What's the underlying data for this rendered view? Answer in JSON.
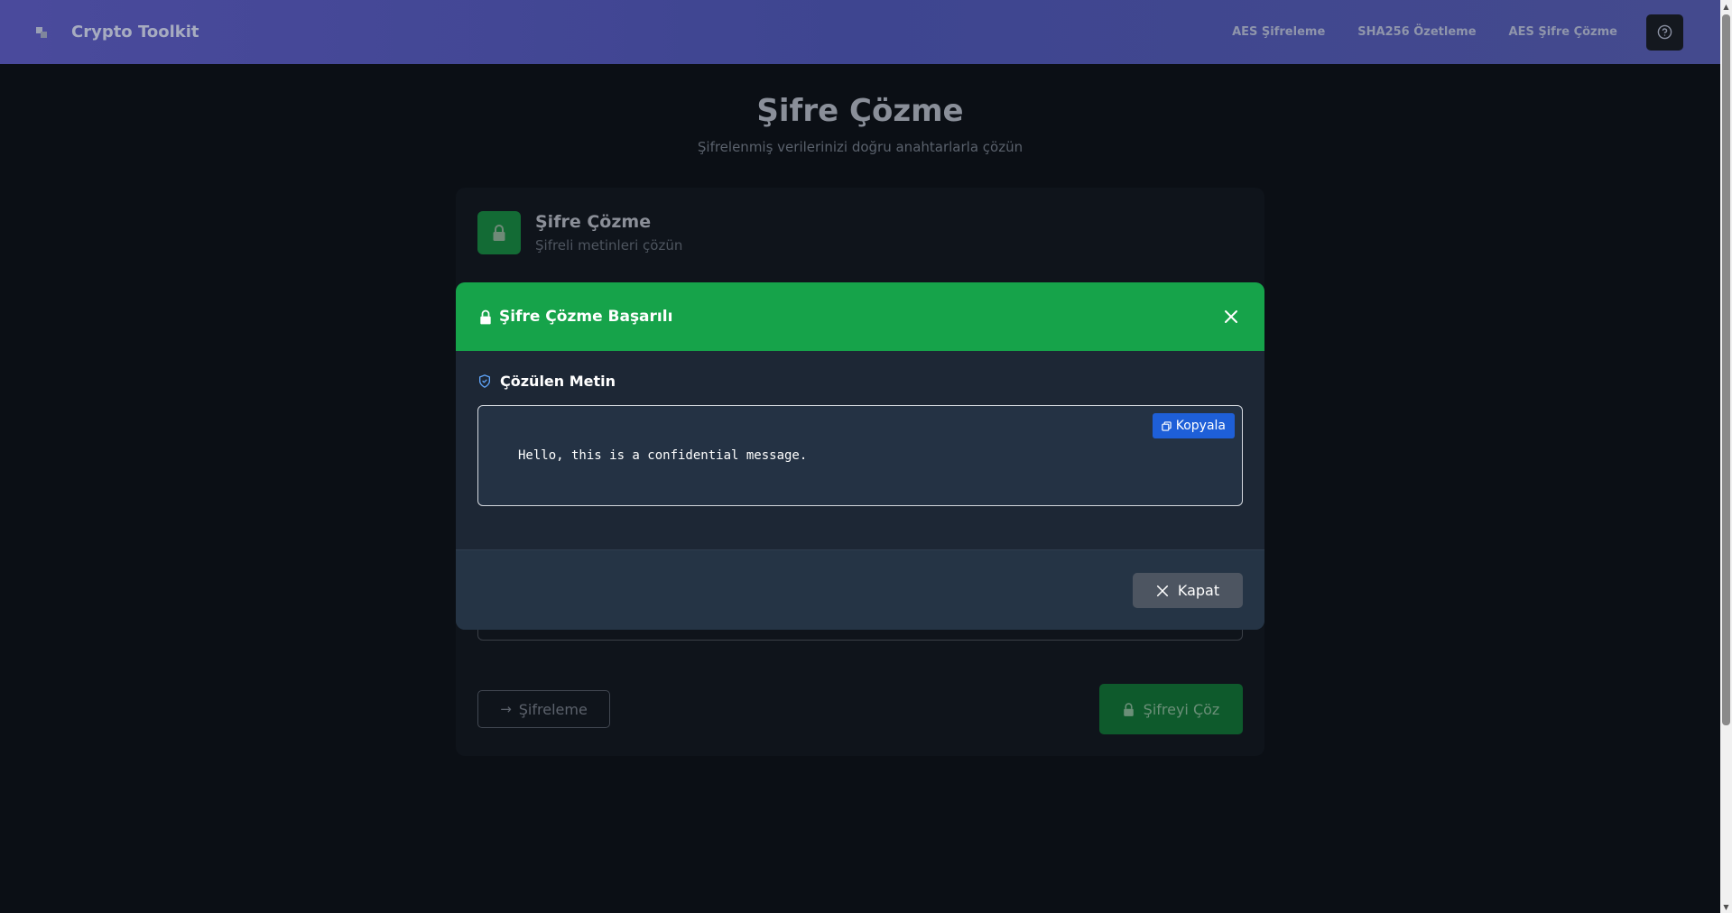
{
  "brand": {
    "name": "Crypto Toolkit",
    "logo_icon": "logo-icon"
  },
  "nav": {
    "links": [
      "AES Şifreleme",
      "SHA256 Özetleme",
      "AES Şifre Çözme"
    ],
    "help_icon": "help-circle-icon"
  },
  "page": {
    "title": "Şifre Çözme",
    "subtitle": "Şifrelenmiş verilerinizi doğru anahtarlarla çözün"
  },
  "card": {
    "title": "Şifre Çözme",
    "subtitle": "Şifreli metinleri çözün",
    "back_label": "Şifreleme",
    "decrypt_label": "Şifreyi Çöz"
  },
  "modal": {
    "title": "Şifre Çözme Başarılı",
    "section_label": "Çözülen Metin",
    "result_text": "Hello, this is a confidential message.",
    "copy_label": "Kopyala",
    "close_label": "Kapat"
  },
  "colors": {
    "success": "#16a34a",
    "copy_button": "#1e5fd8",
    "close_button": "#4d5561",
    "navbar": "#41478f"
  }
}
